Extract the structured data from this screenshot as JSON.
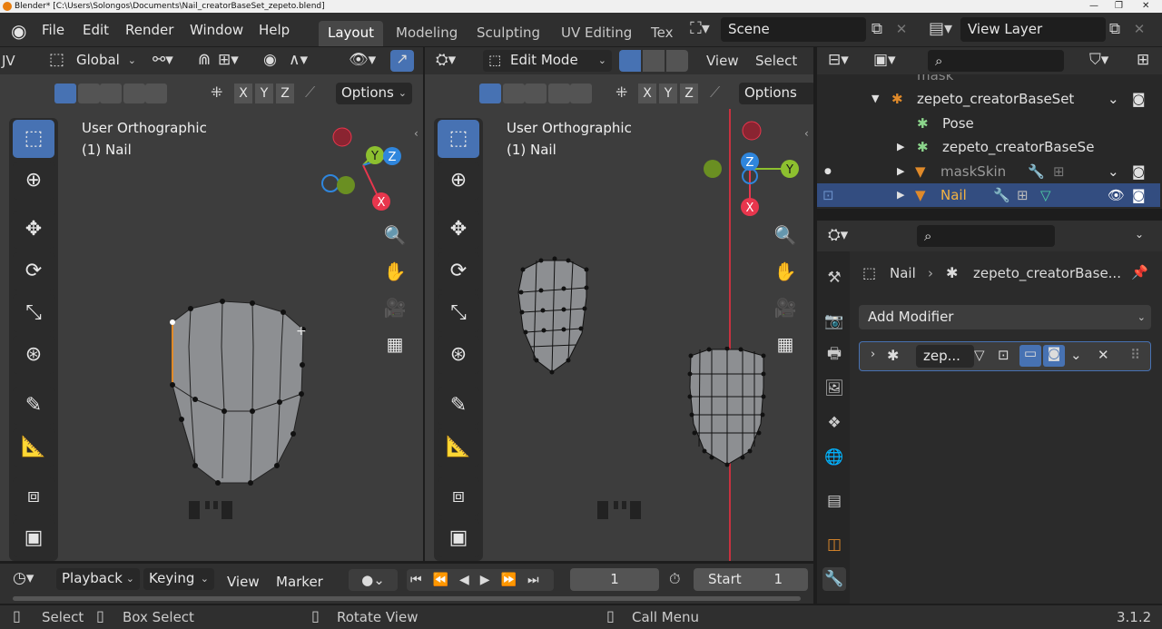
{
  "window": {
    "title": "Blender* [C:\\Users\\Solongos\\Documents\\Nail_creatorBaseSet_zepeto.blend]"
  },
  "menu": {
    "file": "File",
    "edit": "Edit",
    "render": "Render",
    "window": "Window",
    "help": "Help"
  },
  "workspaces": [
    "Layout",
    "Modeling",
    "Sculpting",
    "UV Editing",
    "Tex"
  ],
  "scene": {
    "name": "Scene"
  },
  "view_layer": {
    "name": "View Layer"
  },
  "viewport_left": {
    "mode_prefix": "JV",
    "orientation": "Global",
    "options_label": "Options",
    "view_name": "User Orthographic",
    "object_label": "(1) Nail",
    "axes": [
      "X",
      "Y",
      "Z"
    ]
  },
  "viewport_right": {
    "mode": "Edit Mode",
    "view_menu": "View",
    "select_menu": "Select",
    "options_label": "Options",
    "view_name": "User Orthographic",
    "object_label": "(1) Nail",
    "axes": [
      "X",
      "Y",
      "Z"
    ]
  },
  "outliner": {
    "items": [
      {
        "label": "mask",
        "selected": false
      },
      {
        "label": "zepeto_creatorBaseSet",
        "selected": false
      },
      {
        "label": "Pose",
        "selected": false
      },
      {
        "label": "zepeto_creatorBaseSe",
        "selected": false
      },
      {
        "label": "maskSkin",
        "selected": false
      },
      {
        "label": "Nail",
        "selected": true
      }
    ]
  },
  "properties": {
    "breadcrumb_object": "Nail",
    "breadcrumb_modifier": "zepeto_creatorBase...",
    "add_modifier": "Add Modifier",
    "modifier_name": "zep..."
  },
  "timeline": {
    "playback": "Playback",
    "keying": "Keying",
    "view": "View",
    "marker": "Marker",
    "current_frame": "1",
    "start_label": "Start",
    "start_value": "1"
  },
  "statusbar": {
    "select": "Select",
    "box_select": "Box Select",
    "rotate_view": "Rotate View",
    "call_menu": "Call Menu",
    "version": "3.1.2"
  },
  "colors": {
    "accent": "#4772b3",
    "active_object": "#f4b342",
    "axis_x": "#e8364d",
    "axis_y": "#8dc02f",
    "axis_z": "#2f86dd",
    "window_bg": "#1d1d1d"
  }
}
